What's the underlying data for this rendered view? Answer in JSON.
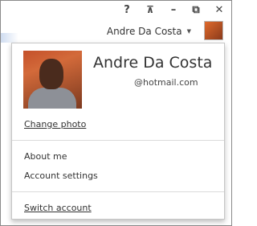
{
  "window": {
    "help_glyph": "?",
    "ribbon_glyph": "⊼",
    "minimize_glyph": "–",
    "restore_glyph": "⧉",
    "close_glyph": "✕"
  },
  "account": {
    "display_name": "Andre Da Costa",
    "email": "@hotmail.com",
    "caret_glyph": "▼"
  },
  "menu": {
    "change_photo": "Change photo",
    "about_me": "About me",
    "account_settings": "Account settings",
    "switch_account": "Switch account"
  },
  "colors": {
    "photo_accent": "#c4502a",
    "text": "#333333"
  }
}
